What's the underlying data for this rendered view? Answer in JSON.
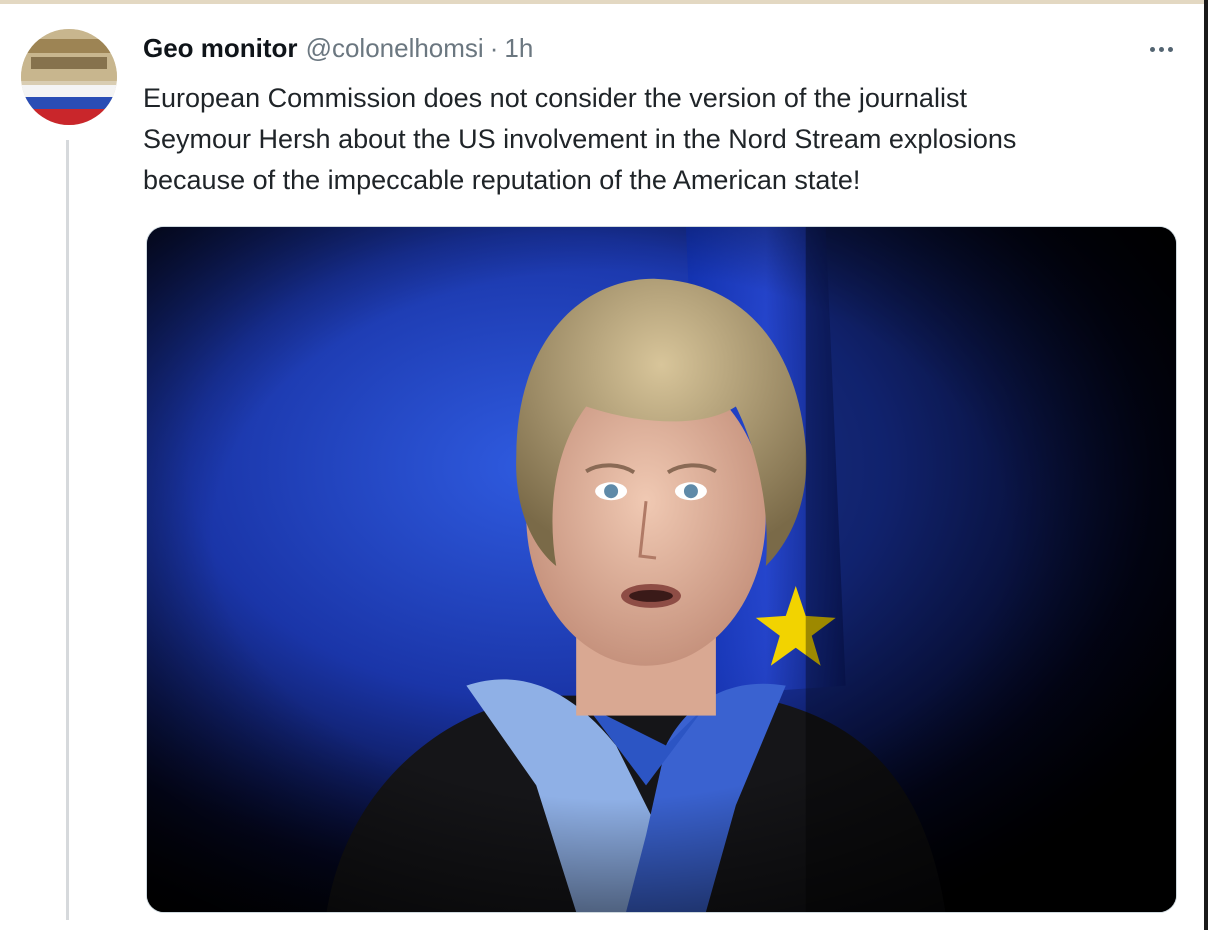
{
  "tweet": {
    "author_name": "Geo monitor",
    "author_handle": "@colonelhomsi",
    "separator": "·",
    "time": "1h",
    "text_lines": [
      "European Commission does not consider the version of the journalist",
      "Seymour Hersh about the US involvement in the Nord Stream explosions",
      "because of the impeccable reputation of the American state!"
    ]
  },
  "icons": {
    "more": "more-horizontal-icon",
    "avatar": "profile-avatar"
  },
  "colors": {
    "name": "#0f1419",
    "secondary_text": "#6b7780",
    "body_text": "#1f2428",
    "thread_line": "#d6d9dc",
    "eu_blue": "#1d3fc4",
    "eu_star": "#f2d300"
  }
}
